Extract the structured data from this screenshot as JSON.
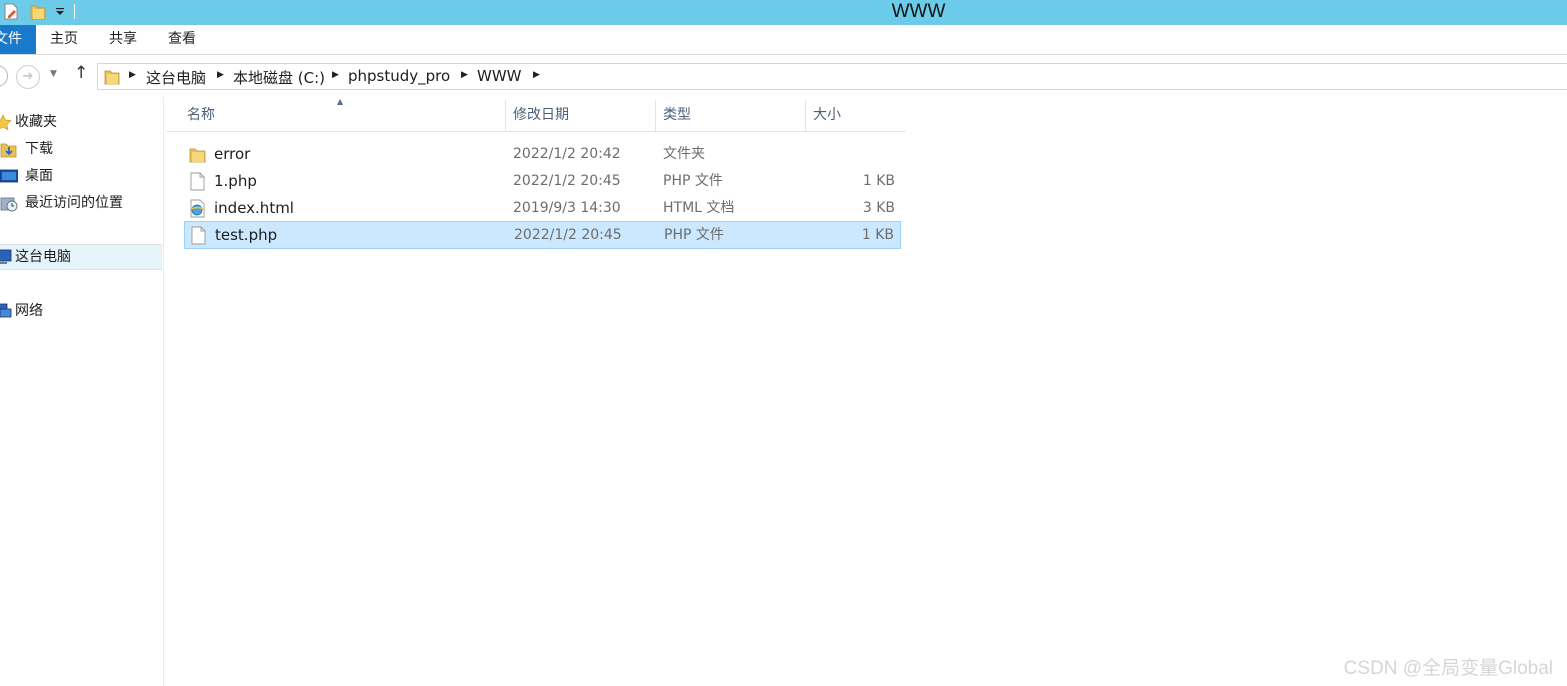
{
  "window": {
    "title": "WWW"
  },
  "ribbon": {
    "tabs": [
      {
        "label": "文件"
      },
      {
        "label": "主页"
      },
      {
        "label": "共享"
      },
      {
        "label": "查看"
      }
    ]
  },
  "address": {
    "crumbs": [
      "这台电脑",
      "本地磁盘 (C:)",
      "phpstudy_pro",
      "WWW"
    ]
  },
  "nav": {
    "items": [
      {
        "label": "收藏夹",
        "icon": "star-icon"
      },
      {
        "label": "下载",
        "icon": "download-folder-icon"
      },
      {
        "label": "桌面",
        "icon": "desktop-icon"
      },
      {
        "label": "最近访问的位置",
        "icon": "recent-places-icon"
      },
      {
        "label": "这台电脑",
        "icon": "computer-icon",
        "selected": true
      },
      {
        "label": "网络",
        "icon": "network-icon"
      }
    ]
  },
  "columns": [
    "名称",
    "修改日期",
    "类型",
    "大小"
  ],
  "files": [
    {
      "name": "error",
      "date": "2022/1/2 20:42",
      "type": "文件夹",
      "size": "",
      "icon": "folder-icon"
    },
    {
      "name": "1.php",
      "date": "2022/1/2 20:45",
      "type": "PHP 文件",
      "size": "1 KB",
      "icon": "file-icon"
    },
    {
      "name": "index.html",
      "date": "2019/9/3 14:30",
      "type": "HTML 文档",
      "size": "3 KB",
      "icon": "html-file-icon"
    },
    {
      "name": "test.php",
      "date": "2022/1/2 20:45",
      "type": "PHP 文件",
      "size": "1 KB",
      "icon": "file-icon",
      "selected": true
    }
  ],
  "watermark": "CSDN @全局变量Global",
  "colors": {
    "titlebar": "#6bcbe9",
    "file_tab": "#1979ca",
    "selection_fill": "#cce8ff",
    "selection_border": "#99d1ff"
  }
}
